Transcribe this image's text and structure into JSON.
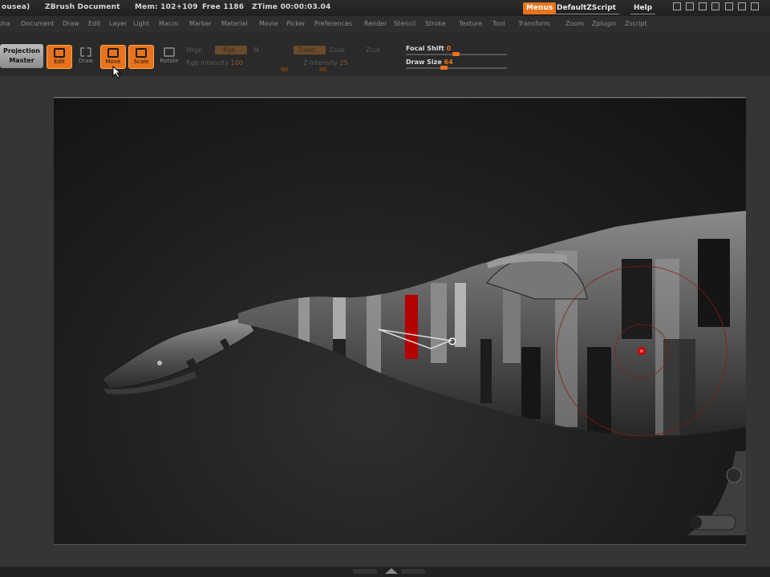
{
  "titlebar": {
    "app_fragment": "ousea)",
    "document": "ZBrush Document",
    "mem": "Mem: 102+109",
    "free": "Free 1186",
    "ztime": "ZTime 00:00:03.04",
    "menus_label": "Menus",
    "script_label": "DefaultZScript",
    "help_label": "Help"
  },
  "menubar": {
    "items": [
      "Alpha",
      "Document",
      "Draw",
      "Edit",
      "Layer",
      "Light",
      "Macro",
      "Marker",
      "Material",
      "Movie",
      "Picker",
      "Preferences",
      "Render",
      "Stencil",
      "Stroke",
      "Texture",
      "Tool",
      "Transform",
      "Zoom",
      "Zplugin",
      "Zscript"
    ]
  },
  "toolbar": {
    "projection_line1": "Projection",
    "projection_line2": "Master",
    "edit_label": "Edit",
    "draw_label": "Draw",
    "move_label": "Move",
    "scale_label": "Scale",
    "rotate_label": "Rotate",
    "mrgb_label": "Mrgb",
    "rgb_label": "Rgb",
    "m_label": "M",
    "zadd_label": "Zadd",
    "zsub_label": "Zsub",
    "zcut_label": "Zcut",
    "rgb_intensity_label": "Rgb Intensity",
    "rgb_intensity_value": "100",
    "z_intensity_label": "Z Intensity",
    "z_intensity_value": "25",
    "focal_shift_label": "Focal Shift",
    "focal_shift_value": "0",
    "draw_size_label": "Draw Size",
    "draw_size_value": "64",
    "focal_shift_fraction": 0.0,
    "draw_size_fraction": 0.12
  },
  "colors": {
    "accent": "#e8731c",
    "canvas_bg": "#1e1e1e",
    "model_base": "#6a6a6a",
    "stripe_dark": "#1a1a1a",
    "stripe_light": "#a8a8a8",
    "mask_red": "#b50000"
  },
  "icons": {
    "edit": "edit-pen-icon",
    "draw": "draw-brush-icon",
    "move": "move-arrows-icon",
    "scale": "scale-box-icon",
    "rotate": "rotate-icon"
  }
}
